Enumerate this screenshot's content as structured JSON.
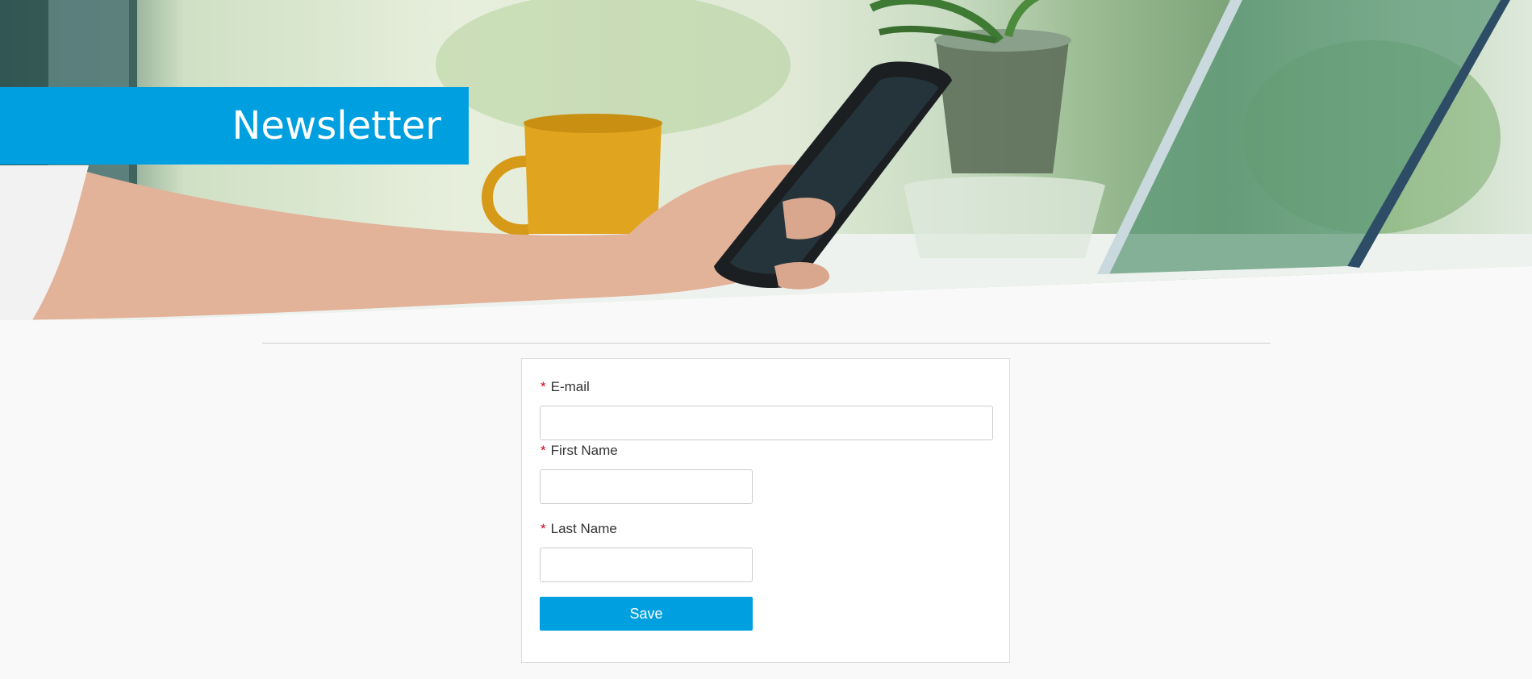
{
  "hero": {
    "title": "Newsletter"
  },
  "form": {
    "required_marker": "*",
    "email_label": "E-mail",
    "email_value": "",
    "first_name_label": "First Name",
    "first_name_value": "",
    "last_name_label": "Last Name",
    "last_name_value": "",
    "save_label": "Save"
  },
  "colors": {
    "accent": "#009fe0",
    "required": "#d8001a",
    "background": "#f9f9f9"
  }
}
